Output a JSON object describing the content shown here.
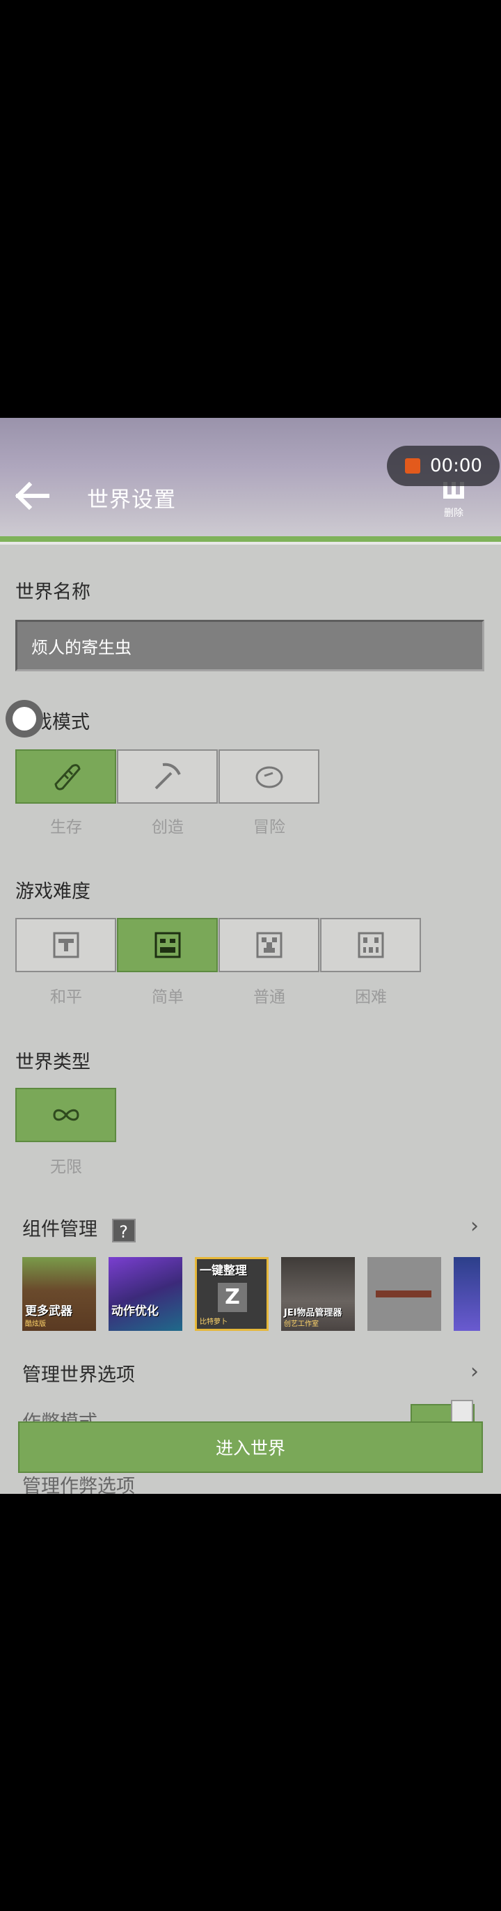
{
  "header": {
    "title": "世界设置",
    "delete_label": "删除"
  },
  "recorder": {
    "time": "00:00",
    "icon": "record-square-icon",
    "color": "#e35a1c"
  },
  "world_name": {
    "section_title": "世界名称",
    "value": "烦人的寄生虫"
  },
  "game_mode": {
    "section_title": "戏模式",
    "options": [
      {
        "label": "生存",
        "icon": "bread-icon",
        "selected": true
      },
      {
        "label": "创造",
        "icon": "pickaxe-icon",
        "selected": false
      },
      {
        "label": "冒险",
        "icon": "compass-icon",
        "selected": false
      }
    ]
  },
  "difficulty": {
    "section_title": "游戏难度",
    "options": [
      {
        "label": "和平",
        "icon": "peaceful-face-icon",
        "selected": false
      },
      {
        "label": "简单",
        "icon": "easy-face-icon",
        "selected": true
      },
      {
        "label": "普通",
        "icon": "creeper-face-icon",
        "selected": false
      },
      {
        "label": "困难",
        "icon": "ghast-face-icon",
        "selected": false
      }
    ]
  },
  "world_type": {
    "section_title": "世界类型",
    "options": [
      {
        "label": "无限",
        "icon": "infinity-icon",
        "selected": true
      }
    ]
  },
  "components": {
    "title": "组件管理",
    "help": "?",
    "mods": [
      {
        "caption": "更多武器",
        "sub": "酷炫版"
      },
      {
        "caption": "动作优化",
        "sub": ""
      },
      {
        "caption": "一键整理",
        "sub": "比特萝卜"
      },
      {
        "caption": "JEI物品管理器",
        "sub": "创艺工作室"
      },
      {
        "caption": "",
        "sub": ""
      },
      {
        "caption": "",
        "sub": ""
      }
    ]
  },
  "manage_world_options": "管理世界选项",
  "cheat_mode": "作弊模式",
  "manage_cheat_options": "管理作弊选项",
  "enter_world": "进入世界",
  "colors": {
    "accent": "#7aa858",
    "accent_dark": "#5d8a40",
    "background": "#c9cac8"
  }
}
